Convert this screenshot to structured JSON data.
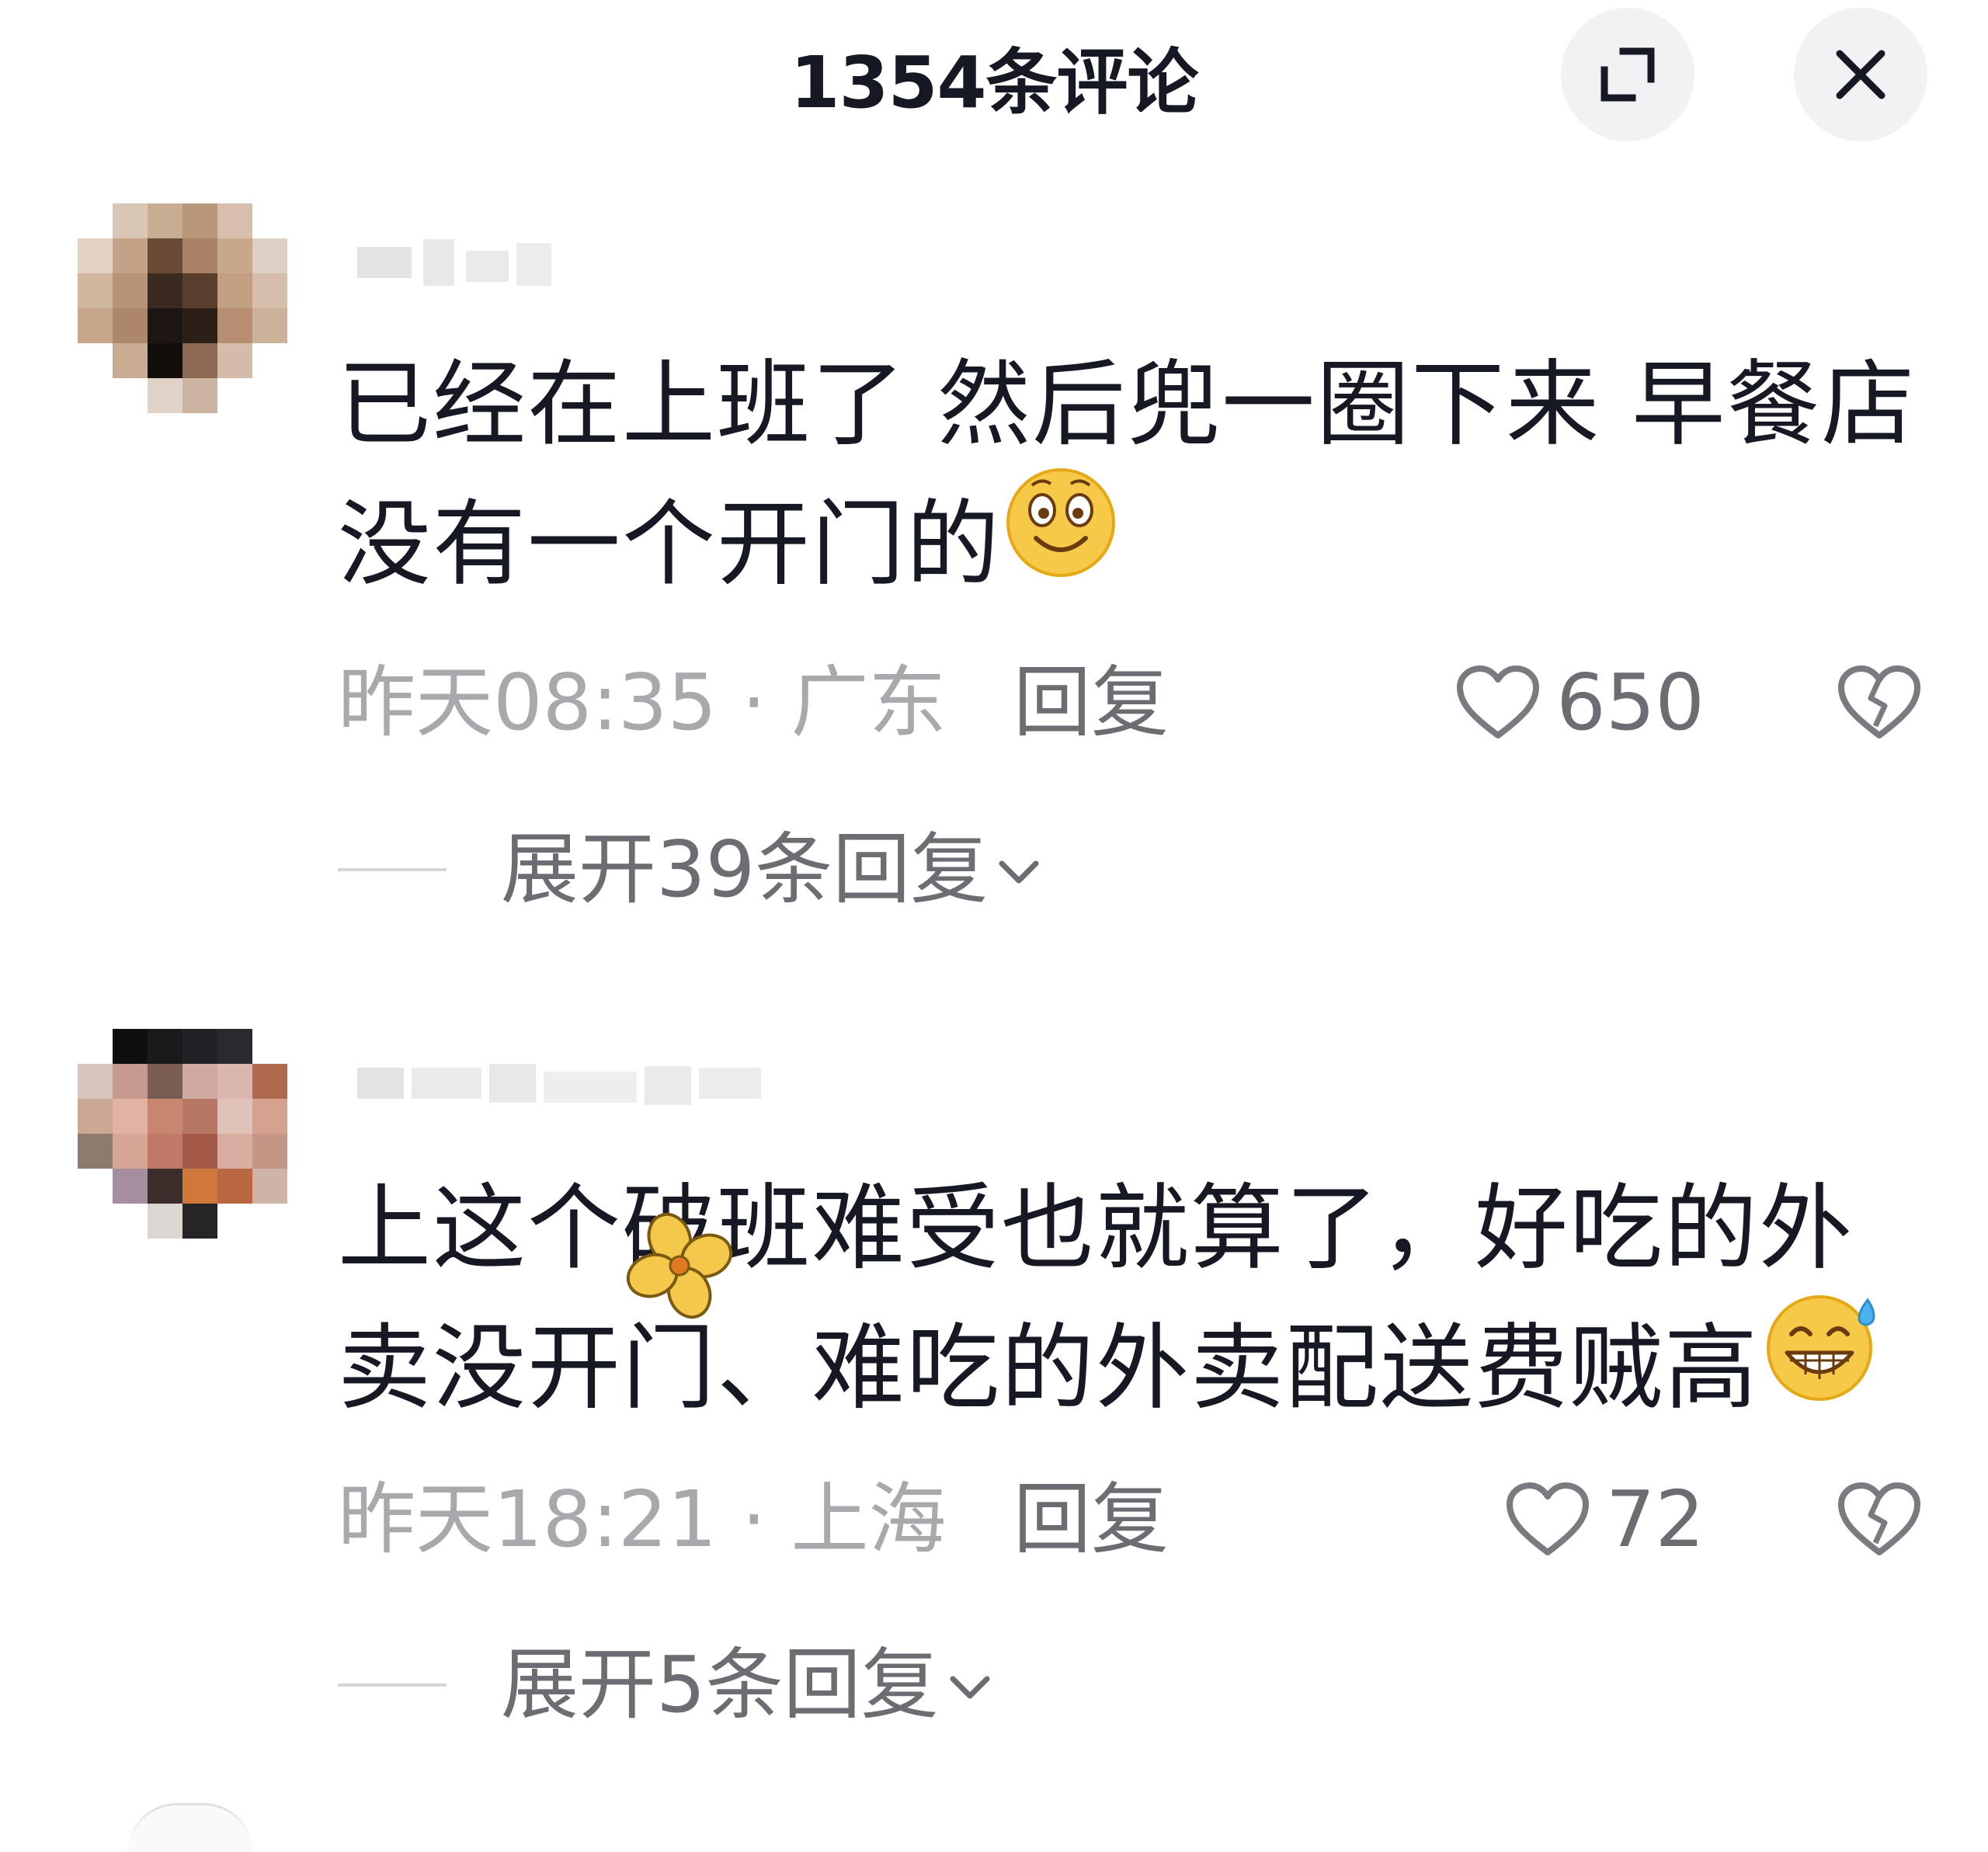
{
  "header": {
    "title": "1354条评论",
    "expand_icon": "expand-icon",
    "close_icon": "close-icon"
  },
  "comments": [
    {
      "text": "已经在上班了 然后兜一圈下来 早餐店没有一个开门的",
      "emoji": "smile-emoji",
      "time_location": "昨天08:35 · 广东",
      "reply_label": "回复",
      "likes": "650",
      "expand_label": "展开39条回复"
    },
    {
      "text": "上这个破班难受也就算了，好吃的外卖没开门、难吃的外卖配送费贼高",
      "emoji": "sweat-grin-emoji",
      "time_location": "昨天18:21 · 上海",
      "reply_label": "回复",
      "likes": "72",
      "expand_label": "展开5条回复"
    }
  ],
  "colors": {
    "text_primary": "#161823",
    "text_meta": "#a8a8ad",
    "text_secondary": "#6c6c72",
    "button_bg": "#f2f2f4"
  }
}
